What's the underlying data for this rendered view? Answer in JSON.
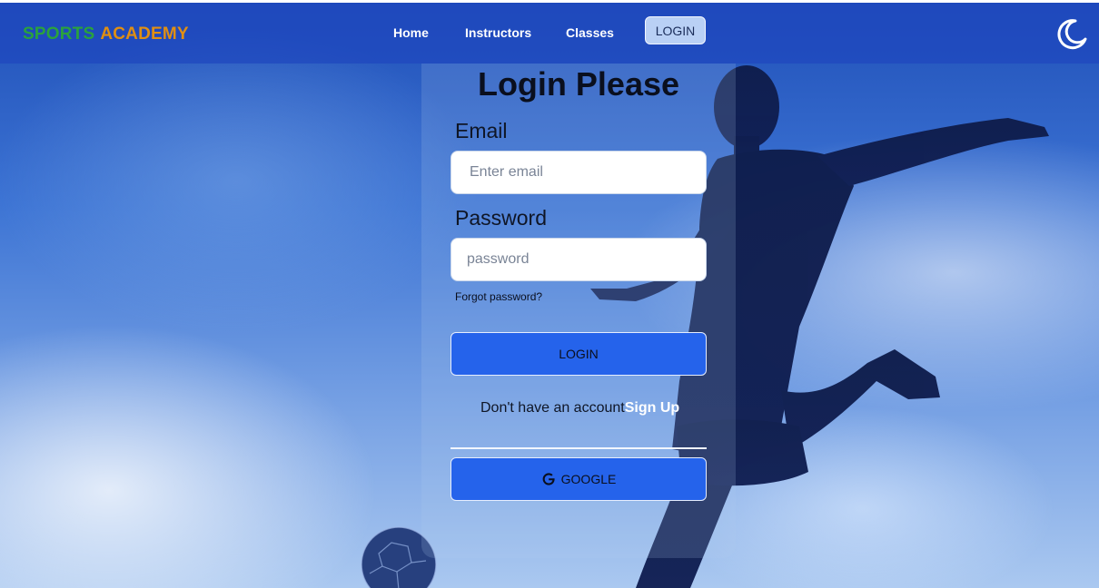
{
  "navbar": {
    "brand_part1": "SPORTS",
    "brand_part2": "ACADEMY",
    "links": [
      "Home",
      "Instructors",
      "Classes"
    ],
    "login_label": "LOGIN",
    "theme_icon": "moon-icon"
  },
  "form": {
    "title": "Login Please",
    "email_label": "Email",
    "email_placeholder": "Enter email",
    "email_value": "",
    "password_label": "Password",
    "password_placeholder": "password",
    "password_value": "",
    "forgot_label": "Forgot password?",
    "login_button": "LOGIN",
    "no_account_text": "Don't have an account",
    "signup_link": "Sign Up",
    "google_button": "GOOGLE",
    "google_icon": "google-icon"
  },
  "colors": {
    "brand_green": "#2aa23d",
    "brand_orange": "#e08f12",
    "primary_button": "#2563eb",
    "navbar": "#1e46be"
  }
}
